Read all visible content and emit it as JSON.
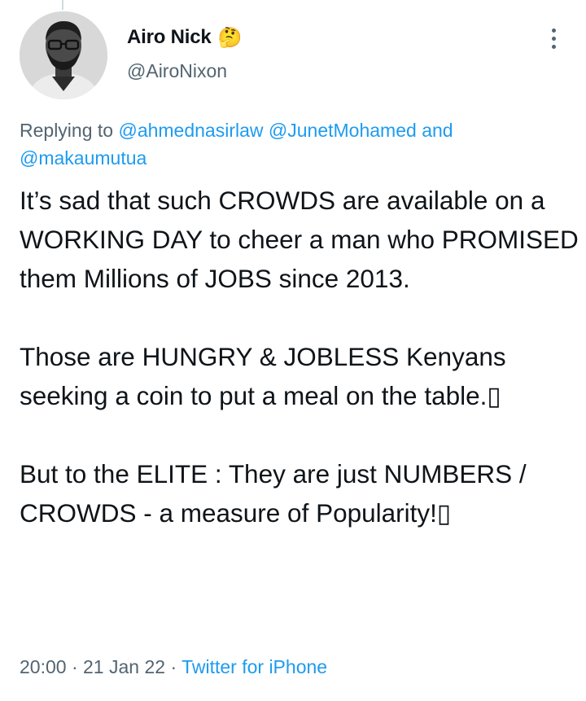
{
  "author": {
    "name": "Airo Nick",
    "name_emoji": "🤔",
    "handle": "@AiroNixon"
  },
  "more_icon": "more-horizontal-dots-icon",
  "replying": {
    "prefix": "Replying to",
    "mention_1": "@ahmednasirlaw",
    "mention_2": "@JunetMohamed",
    "conjunction": "and",
    "mention_3": "@makaumutua"
  },
  "tweet": {
    "paragraph_1": "It’s sad that such CROWDS are available on a WORKING DAY to cheer a man who PROMISED them Millions of JOBS since 2013.",
    "paragraph_2": "Those are HUNGRY & JOBLESS Kenyans seeking a coin to put a meal on the table.▯",
    "paragraph_3": "But to the ELITE : They are just NUMBERS / CROWDS  - a measure of Popularity!▯"
  },
  "meta": {
    "time": "20:00",
    "separator": "·",
    "date": "21 Jan 22",
    "source": "Twitter for iPhone"
  },
  "colors": {
    "link": "#1d9bf0",
    "secondary_text": "#536471",
    "primary_text": "#0f1419"
  }
}
